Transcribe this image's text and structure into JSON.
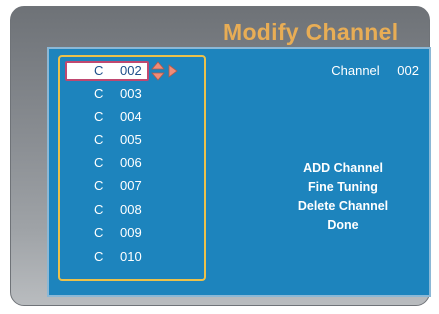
{
  "title": "Modify Channel",
  "channel_info": {
    "label": "Channel",
    "number": "002"
  },
  "channels": [
    {
      "prefix": "C",
      "number": "002",
      "selected": true
    },
    {
      "prefix": "C",
      "number": "003"
    },
    {
      "prefix": "C",
      "number": "004"
    },
    {
      "prefix": "C",
      "number": "005"
    },
    {
      "prefix": "C",
      "number": "006"
    },
    {
      "prefix": "C",
      "number": "007"
    },
    {
      "prefix": "C",
      "number": "008"
    },
    {
      "prefix": "C",
      "number": "009"
    },
    {
      "prefix": "C",
      "number": "010"
    }
  ],
  "menu": {
    "add_channel": "ADD Channel",
    "fine_tuning": "Fine Tuning",
    "delete_channel": "Delete Channel",
    "done": "Done"
  },
  "icons": {
    "selection": "up-down-arrows-icon",
    "submenu": "right-arrow-icon"
  },
  "colors": {
    "panel": "#1d84bd",
    "title": "#e8ad55",
    "list_border": "#ecc14a",
    "selection_border": "#c04870",
    "arrow": "#f08c78"
  }
}
